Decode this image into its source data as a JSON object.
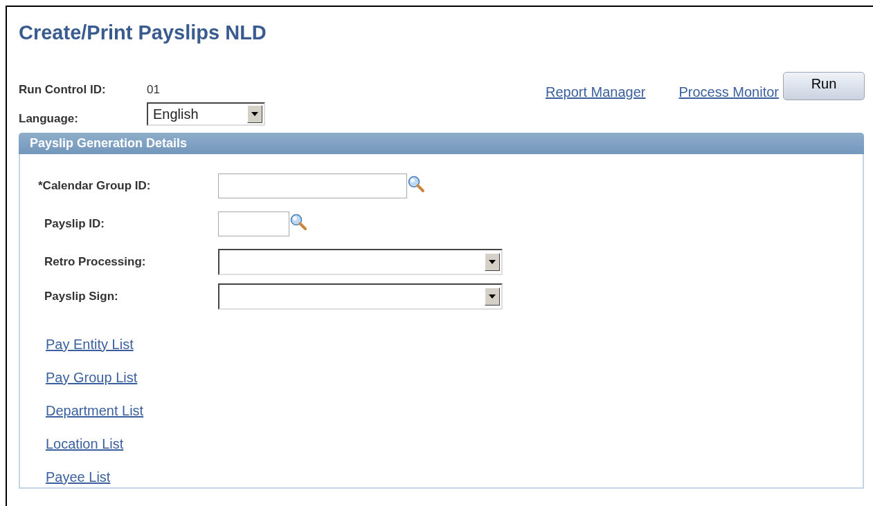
{
  "page_title": "Create/Print Payslips NLD",
  "run_control": {
    "label": "Run Control ID:",
    "value": "01"
  },
  "language": {
    "label": "Language:",
    "value": "English"
  },
  "header_links": [
    "Report Manager",
    "Process Monitor"
  ],
  "run_button": "Run",
  "panel": {
    "title": "Payslip Generation Details",
    "fields": [
      {
        "kind": "lookup",
        "label": "*Calendar Group ID:"
      },
      {
        "kind": "short_lookup",
        "label": "Payslip ID:"
      },
      {
        "kind": "dropdown",
        "label": "Retro Processing:"
      },
      {
        "kind": "dropdown",
        "label": "Payslip Sign:"
      }
    ],
    "links": [
      "Pay Entity List",
      "Pay Group List",
      "Department List",
      "Location List",
      "Payee List"
    ]
  }
}
